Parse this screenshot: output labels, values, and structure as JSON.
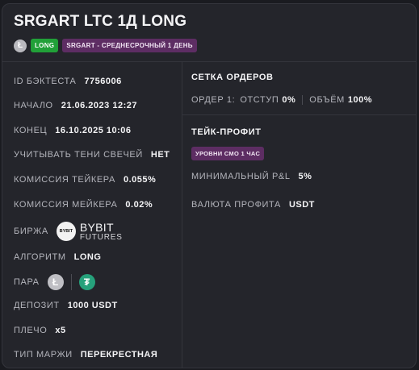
{
  "title": "SRGART LTC 1Д LONG",
  "badges": {
    "coin_icon": "litecoin-icon",
    "direction": "LONG",
    "strategy": "SRGART - СРЕДНЕСРОЧНЫЙ 1 ДЕНЬ"
  },
  "details": {
    "backtest_id": {
      "label": "ID БЭКТЕСТА",
      "value": "7756006"
    },
    "start": {
      "label": "НАЧАЛО",
      "value": "21.06.2023 12:27"
    },
    "end": {
      "label": "КОНЕЦ",
      "value": "16.10.2025 10:06"
    },
    "shadows": {
      "label": "УЧИТЫВАТЬ ТЕНИ СВЕЧЕЙ",
      "value": "НЕТ"
    },
    "taker_fee": {
      "label": "КОМИССИЯ ТЕЙКЕРА",
      "value": "0.055%"
    },
    "maker_fee": {
      "label": "КОМИССИЯ МЕЙКЕРА",
      "value": "0.02%"
    },
    "exchange": {
      "label": "БИРЖА",
      "logo_text": "BYBIT",
      "name": "BYBIT",
      "sub": "FUTURES"
    },
    "algorithm": {
      "label": "АЛГОРИТМ",
      "value": "LONG"
    },
    "pair": {
      "label": "ПАРА",
      "base_icon": "litecoin-icon",
      "quote_icon": "tether-icon"
    },
    "deposit": {
      "label": "ДЕПОЗИТ",
      "value": "1000 USDT"
    },
    "leverage": {
      "label": "ПЛЕЧО",
      "value": "x5"
    },
    "margin": {
      "label": "ТИП МАРЖИ",
      "value": "ПЕРЕКРЕСТНАЯ"
    }
  },
  "orders": {
    "title": "СЕТКА ОРДЕРОВ",
    "order_label": "ОРДЕР 1:",
    "offset_label": "ОТСТУП",
    "offset_value": "0%",
    "volume_label": "ОБЪЁМ",
    "volume_value": "100%"
  },
  "take_profit": {
    "title": "ТЕЙК-ПРОФИТ",
    "badge": "УРОВНИ СМО 1 ЧАС",
    "min_pnl_label": "МИНИМАЛЬНЫЙ P&L",
    "min_pnl_value": "5%",
    "currency_label": "ВАЛЮТА ПРОФИТА",
    "currency_value": "USDT"
  },
  "colors": {
    "background": "#24252b",
    "accent_green": "#21a038",
    "accent_purple": "#5d2d63",
    "tether_green": "#26a17b"
  }
}
